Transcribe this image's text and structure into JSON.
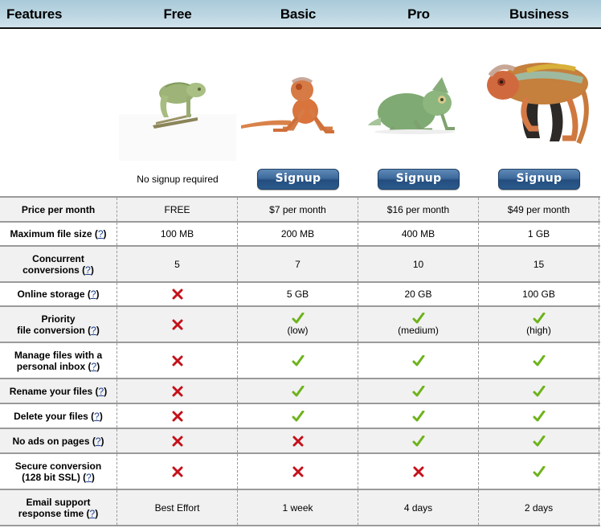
{
  "header": {
    "features_label": "Features",
    "plans": [
      "Free",
      "Basic",
      "Pro",
      "Business"
    ]
  },
  "plans": [
    {
      "name": "Free",
      "image": "green-chameleon-on-branch",
      "cta_type": "text",
      "cta_text": "No signup required"
    },
    {
      "name": "Basic",
      "image": "orange-chameleon",
      "cta_type": "button",
      "cta_text": "Signup"
    },
    {
      "name": "Pro",
      "image": "green-chameleon-crouching",
      "cta_type": "button",
      "cta_text": "Signup"
    },
    {
      "name": "Business",
      "image": "multicolor-panther-chameleon",
      "cta_type": "button",
      "cta_text": "Signup"
    }
  ],
  "help_link_text": "?",
  "colors": {
    "header_gradient_top": "#a9cad9",
    "header_gradient_bottom": "#cfe2eb",
    "button_blue": "#2b5a8c",
    "check_green": "#6db31b",
    "cross_red": "#c4111a",
    "help_link": "#1a3f8f",
    "row_alt": "#f1f1f1"
  },
  "rows": [
    {
      "feature": [
        "Price per month"
      ],
      "help": false,
      "values": [
        {
          "type": "text",
          "text": "FREE"
        },
        {
          "type": "text",
          "text": "$7 per month"
        },
        {
          "type": "text",
          "text": "$16 per month"
        },
        {
          "type": "text",
          "text": "$49 per month"
        }
      ]
    },
    {
      "feature": [
        "Maximum file size"
      ],
      "help": true,
      "values": [
        {
          "type": "text",
          "text": "100 MB"
        },
        {
          "type": "text",
          "text": "200 MB"
        },
        {
          "type": "text",
          "text": "400 MB"
        },
        {
          "type": "text",
          "text": "1 GB"
        }
      ]
    },
    {
      "feature": [
        "Concurrent",
        "conversions"
      ],
      "help": true,
      "values": [
        {
          "type": "text",
          "text": "5"
        },
        {
          "type": "text",
          "text": "7"
        },
        {
          "type": "text",
          "text": "10"
        },
        {
          "type": "text",
          "text": "15"
        }
      ]
    },
    {
      "feature": [
        "Online storage"
      ],
      "help": true,
      "values": [
        {
          "type": "cross"
        },
        {
          "type": "text",
          "text": "5 GB"
        },
        {
          "type": "text",
          "text": "20 GB"
        },
        {
          "type": "text",
          "text": "100 GB"
        }
      ]
    },
    {
      "feature": [
        "Priority",
        "file conversion"
      ],
      "help": true,
      "values": [
        {
          "type": "cross"
        },
        {
          "type": "check",
          "text": "(low)"
        },
        {
          "type": "check",
          "text": "(medium)"
        },
        {
          "type": "check",
          "text": "(high)"
        }
      ]
    },
    {
      "feature": [
        "Manage files with a",
        "personal inbox"
      ],
      "help": true,
      "values": [
        {
          "type": "cross"
        },
        {
          "type": "check"
        },
        {
          "type": "check"
        },
        {
          "type": "check"
        }
      ]
    },
    {
      "feature": [
        "Rename your files"
      ],
      "help": true,
      "values": [
        {
          "type": "cross"
        },
        {
          "type": "check"
        },
        {
          "type": "check"
        },
        {
          "type": "check"
        }
      ]
    },
    {
      "feature": [
        "Delete your files"
      ],
      "help": true,
      "values": [
        {
          "type": "cross"
        },
        {
          "type": "check"
        },
        {
          "type": "check"
        },
        {
          "type": "check"
        }
      ]
    },
    {
      "feature": [
        "No ads on pages"
      ],
      "help": true,
      "values": [
        {
          "type": "cross"
        },
        {
          "type": "cross"
        },
        {
          "type": "check"
        },
        {
          "type": "check"
        }
      ]
    },
    {
      "feature": [
        "Secure conversion",
        "(128 bit SSL)"
      ],
      "help": true,
      "values": [
        {
          "type": "cross"
        },
        {
          "type": "cross"
        },
        {
          "type": "cross"
        },
        {
          "type": "check"
        }
      ]
    },
    {
      "feature": [
        "Email support",
        "response time"
      ],
      "help": true,
      "values": [
        {
          "type": "text",
          "text": "Best Effort"
        },
        {
          "type": "text",
          "text": "1 week"
        },
        {
          "type": "text",
          "text": "4 days"
        },
        {
          "type": "text",
          "text": "2 days"
        }
      ]
    }
  ]
}
